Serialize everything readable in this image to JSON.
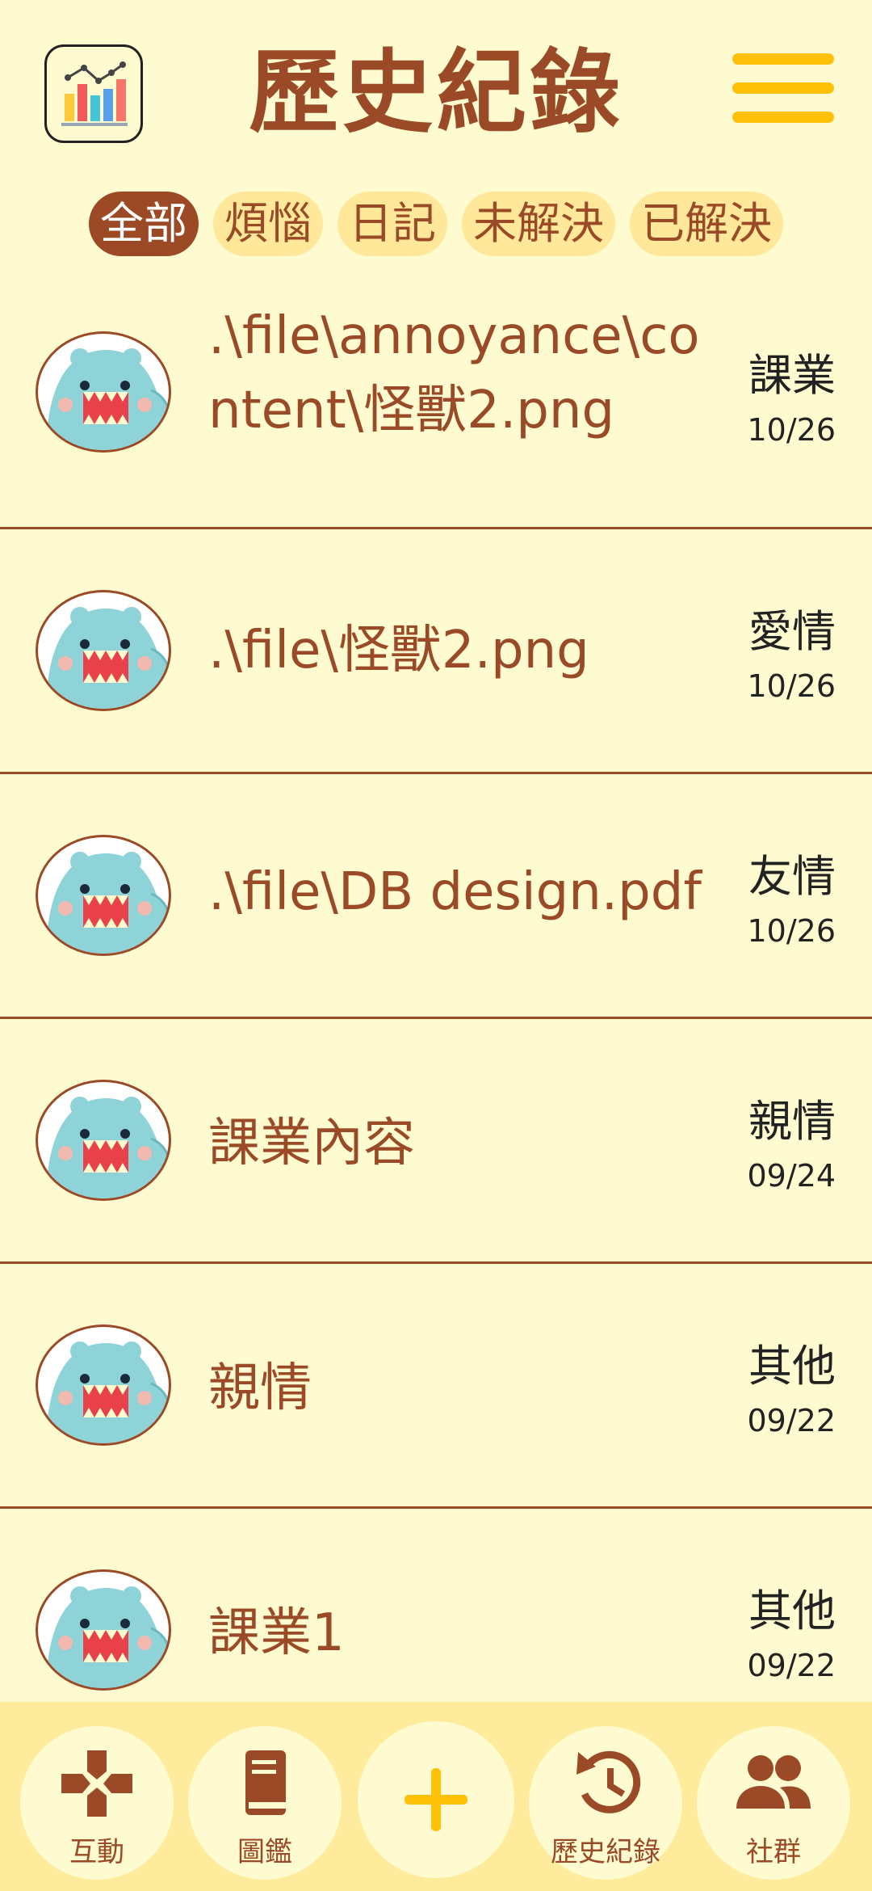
{
  "header": {
    "title": "歷史紀錄",
    "chart_icon": "bar-chart-icon",
    "menu_icon": "hamburger-menu-icon"
  },
  "filters": [
    {
      "label": "全部",
      "active": true
    },
    {
      "label": "煩惱",
      "active": false
    },
    {
      "label": "日記",
      "active": false
    },
    {
      "label": "未解決",
      "active": false
    },
    {
      "label": "已解決",
      "active": false
    }
  ],
  "records": [
    {
      "title": ".\\file\\annoyance\\content\\怪獸2.png",
      "category": "課業",
      "date": "10/26"
    },
    {
      "title": ".\\file\\怪獸2.png",
      "category": "愛情",
      "date": "10/26"
    },
    {
      "title": ".\\file\\DB design.pdf",
      "category": "友情",
      "date": "10/26"
    },
    {
      "title": "課業內容",
      "category": "親情",
      "date": "09/24"
    },
    {
      "title": "親情",
      "category": "其他",
      "date": "09/22"
    },
    {
      "title": "課業1",
      "category": "其他",
      "date": "09/22"
    }
  ],
  "bottom_nav": [
    {
      "label": "互動",
      "icon": "gamepad-icon"
    },
    {
      "label": "圖鑑",
      "icon": "book-icon"
    },
    {
      "label": "",
      "icon": "add-icon"
    },
    {
      "label": "歷史紀錄",
      "icon": "history-icon"
    },
    {
      "label": "社群",
      "icon": "group-icon"
    }
  ],
  "colors": {
    "background": "#FFFBD1",
    "accent_brown": "#9A4A26",
    "accent_yellow": "#FFC107",
    "chip_bg": "#FFE89A",
    "nav_bg": "#FFEB9C"
  }
}
